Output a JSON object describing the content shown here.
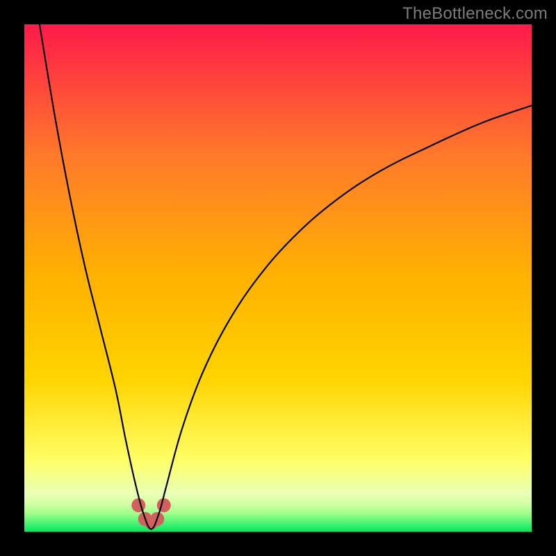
{
  "watermark": "TheBottleneck.com",
  "chart_data": {
    "type": "line",
    "title": "",
    "xlabel": "",
    "ylabel": "",
    "xlim": [
      0,
      100
    ],
    "ylim": [
      0,
      100
    ],
    "grid": false,
    "legend": false,
    "background_gradient": {
      "top": "#ff1a4a",
      "mid_upper": "#ff7a2a",
      "mid": "#ffd400",
      "mid_lower": "#ffff66",
      "band_light": "#e9ffb5",
      "bottom": "#00e85e"
    },
    "axes_visible": false,
    "series": [
      {
        "name": "bottleneck-curve",
        "x": [
          3,
          6,
          9,
          12,
          15,
          18,
          20,
          22,
          23.5,
          25,
          26.5,
          28,
          31,
          35,
          40,
          46,
          53,
          61,
          70,
          80,
          90,
          100
        ],
        "y": [
          100,
          82,
          66,
          52,
          40,
          28,
          18,
          9,
          3.5,
          0.5,
          3.5,
          9,
          20,
          31,
          41,
          50,
          58,
          65,
          71,
          76,
          80.5,
          84
        ],
        "stroke": "#000000",
        "stroke_width": 2.2
      }
    ],
    "markers": [
      {
        "name": "highlight-cluster",
        "color": "#d1605e",
        "radius": 10,
        "points": [
          {
            "x": 22.5,
            "y": 5.2
          },
          {
            "x": 23.8,
            "y": 2.5
          },
          {
            "x": 25.0,
            "y": 1.8
          },
          {
            "x": 26.2,
            "y": 2.5
          },
          {
            "x": 27.5,
            "y": 5.2
          }
        ]
      }
    ]
  }
}
